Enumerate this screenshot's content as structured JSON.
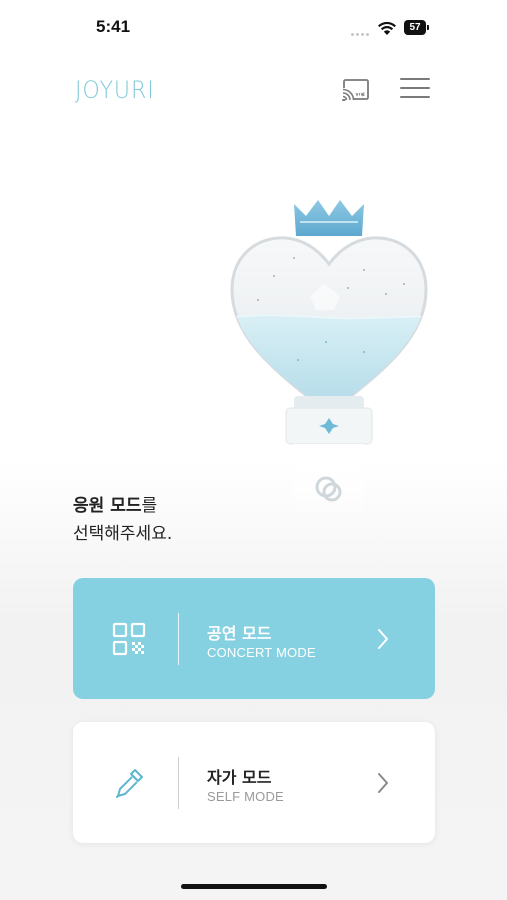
{
  "status_bar": {
    "time": "5:41",
    "battery": "57"
  },
  "header": {
    "logo": "JOYURI",
    "icons": [
      "cast-icon",
      "menu-icon"
    ]
  },
  "hero": {
    "image": "heart-lightstick",
    "heading_bold": "응원 모드",
    "heading_suffix": "를",
    "heading_line2": "선택해주세요."
  },
  "modes": [
    {
      "title": "공연 모드",
      "subtitle": "CONCERT MODE",
      "icon": "qr-code-icon"
    },
    {
      "title": "자가 모드",
      "subtitle": "SELF MODE",
      "icon": "eyedropper-icon"
    }
  ],
  "colors": {
    "accent": "#86d1e1",
    "logo": "#7fc9d8",
    "text": "#222222",
    "subtext": "#9a9a9a"
  }
}
